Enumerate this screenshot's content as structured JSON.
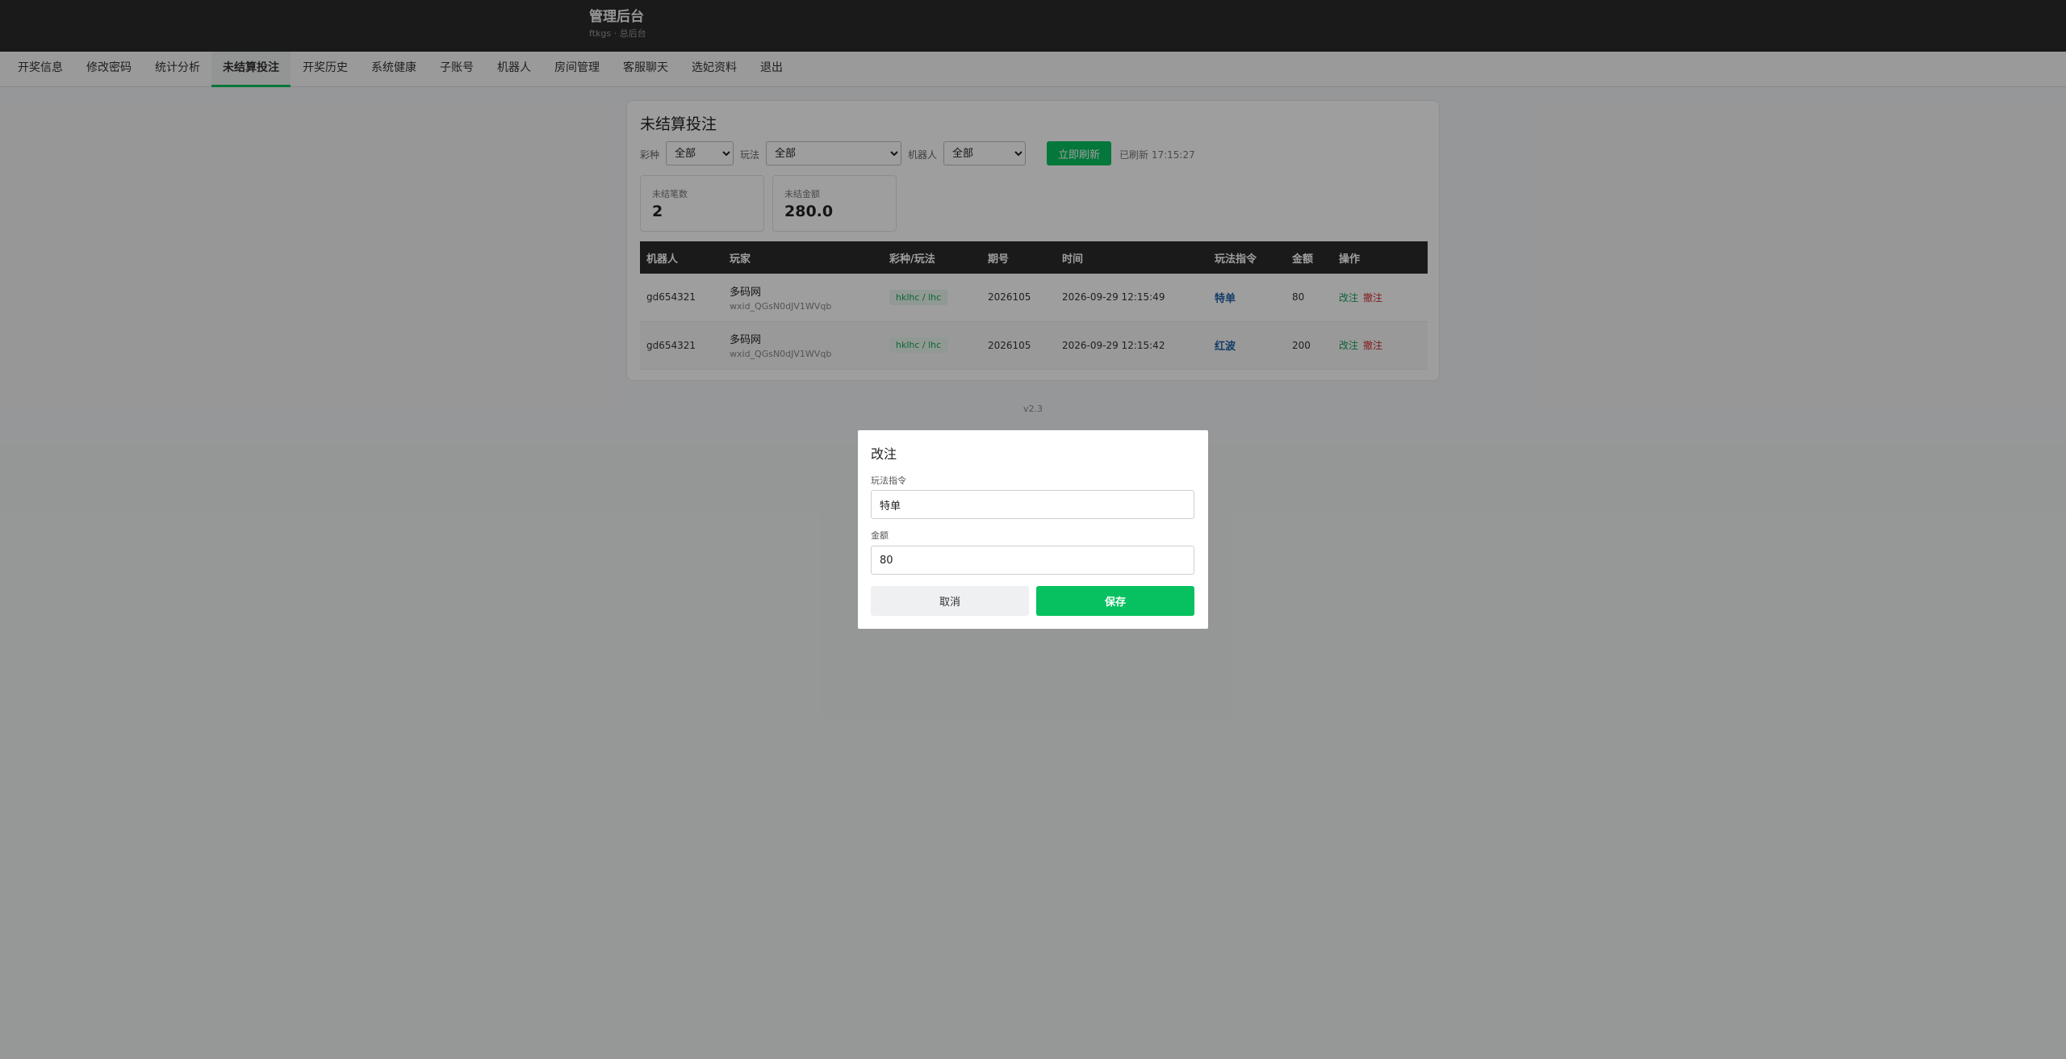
{
  "header": {
    "title": "管理后台",
    "subtitle": "ftkgs · 总后台"
  },
  "nav": {
    "tabs": [
      {
        "label": "开奖信息"
      },
      {
        "label": "修改密码"
      },
      {
        "label": "统计分析"
      },
      {
        "label": "未结算投注",
        "active": true
      },
      {
        "label": "开奖历史"
      },
      {
        "label": "系统健康"
      },
      {
        "label": "子账号"
      },
      {
        "label": "机器人"
      },
      {
        "label": "房间管理"
      },
      {
        "label": "客服聊天"
      },
      {
        "label": "选妃资料"
      },
      {
        "label": "退出"
      }
    ]
  },
  "page": {
    "title": "未结算投注",
    "filters": {
      "lottery_label": "彩种",
      "lottery_value": "全部",
      "play_label": "玩法",
      "play_value": "全部",
      "robot_label": "机器人",
      "robot_value": "全部",
      "refresh_button": "立即刷新",
      "refreshed_text": "已刷新 17:15:27"
    },
    "stats": {
      "count_label": "未结笔数",
      "count_value": "2",
      "amount_label": "未结金额",
      "amount_value": "280.0"
    },
    "table": {
      "headers": [
        "机器人",
        "玩家",
        "彩种/玩法",
        "期号",
        "时间",
        "玩法指令",
        "金额",
        "操作"
      ],
      "rows": [
        {
          "robot": "gd654321",
          "player_name": "多码网",
          "player_id": "wxid_QGsN0dJV1WVqb",
          "lottery": "hklhc / lhc",
          "period": "2026105",
          "time": "2026-09-29 12:15:49",
          "command": "特单",
          "amount": "80",
          "action_edit": "改注",
          "action_cancel": "撤注"
        },
        {
          "robot": "gd654321",
          "player_name": "多码网",
          "player_id": "wxid_QGsN0dJV1WVqb",
          "lottery": "hklhc / lhc",
          "period": "2026105",
          "time": "2026-09-29 12:15:42",
          "command": "红波",
          "amount": "200",
          "action_edit": "改注",
          "action_cancel": "撤注"
        }
      ]
    },
    "version": "v2.3"
  },
  "modal": {
    "title": "改注",
    "command_label": "玩法指令",
    "command_value": "特单",
    "amount_label": "金额",
    "amount_value": "80",
    "cancel_button": "取消",
    "save_button": "保存"
  },
  "colors": {
    "accent": "#07c160",
    "header_bg": "#2b2b2b",
    "link_blue": "#1e5fa8",
    "danger": "#d03030"
  }
}
